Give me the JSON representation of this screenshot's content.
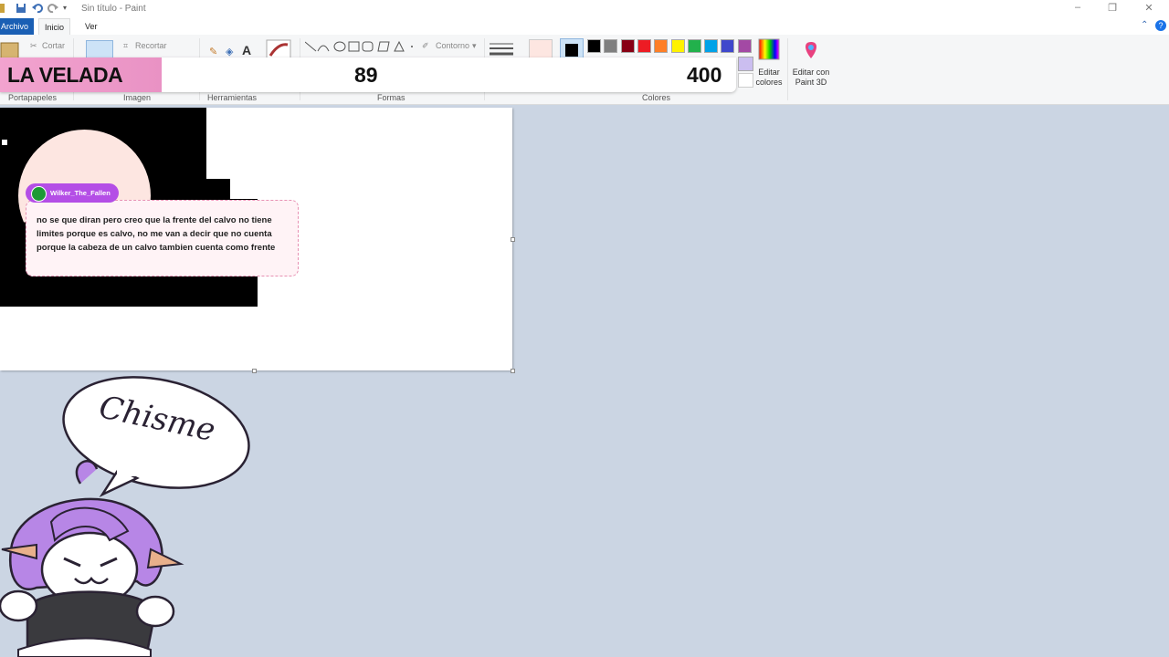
{
  "window": {
    "title": "Sin título - Paint"
  },
  "tabs": {
    "file": "Archivo",
    "home": "Inicio",
    "view": "Ver"
  },
  "ribbon": {
    "clipboard": {
      "cut": "Cortar",
      "group": "Portapapeles"
    },
    "image": {
      "crop": "Recortar",
      "group": "Imagen"
    },
    "tools": {
      "group": "Herramientas"
    },
    "shapes": {
      "outline": "Contorno",
      "group": "Formas"
    },
    "colors": {
      "group": "Colores",
      "edit_colors_line1": "Editar",
      "edit_colors_line2": "colores",
      "paint3d_line1": "Editar con",
      "paint3d_line2": "Paint 3D",
      "palette": [
        "#000000",
        "#7f7f7f",
        "#880015",
        "#ed1c24",
        "#ff7f27",
        "#fff200",
        "#22b14c",
        "#00a2e8",
        "#3f48cc",
        "#a349a4"
      ],
      "color1": "#000000",
      "color2": "#fde6e1"
    }
  },
  "score": {
    "team": "LA VELADA",
    "left_value": "89",
    "right_value": "400",
    "accent": "#f2a3cf"
  },
  "chat": {
    "username": "Wilker_The_Fallen",
    "message": "no se que diran pero creo que la frente del calvo no tiene limites porque es calvo, no me van a decir que no cuenta porque la cabeza de un calvo tambien cuenta como frente"
  },
  "sticker": {
    "caption": "Chisme"
  }
}
